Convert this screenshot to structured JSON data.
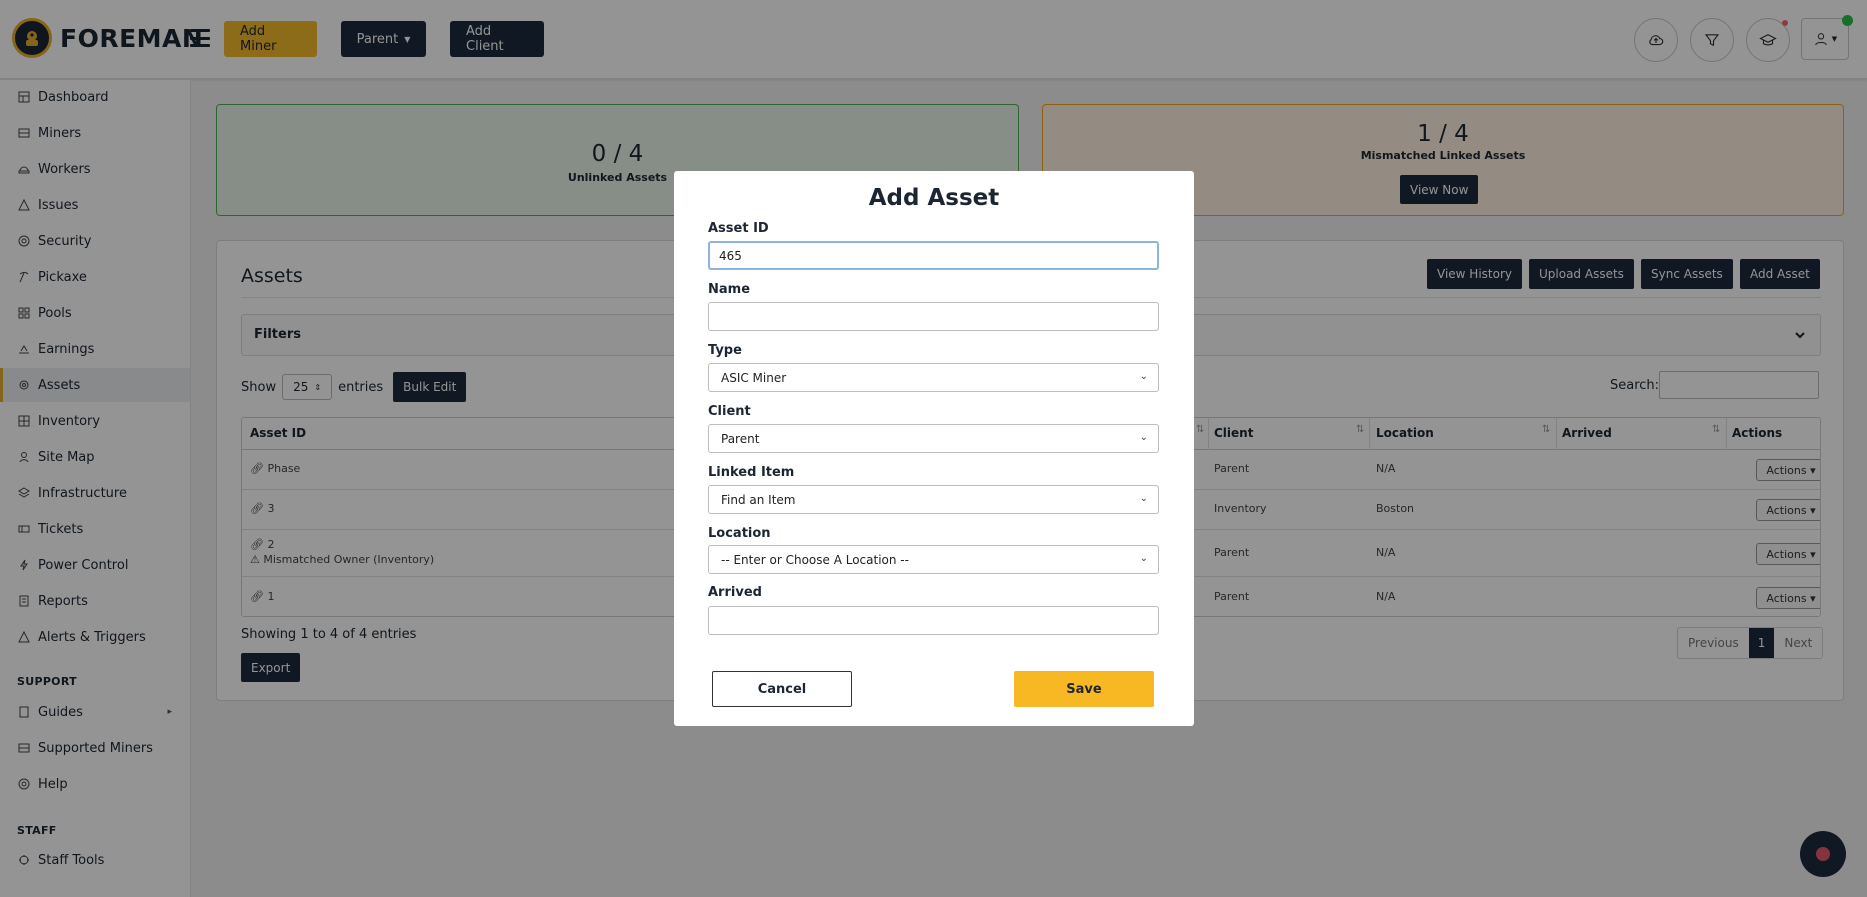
{
  "header": {
    "logo_text": "FOREMAN",
    "add_miner_label": "Add Miner",
    "parent_label": "Parent",
    "add_client_label": "Add Client"
  },
  "sidebar": {
    "items": [
      {
        "label": "Dashboard",
        "icon": "dashboard-icon"
      },
      {
        "label": "Miners",
        "icon": "miners-icon"
      },
      {
        "label": "Workers",
        "icon": "workers-icon"
      },
      {
        "label": "Issues",
        "icon": "issues-icon"
      },
      {
        "label": "Security",
        "icon": "security-icon"
      },
      {
        "label": "Pickaxe",
        "icon": "pickaxe-icon"
      },
      {
        "label": "Pools",
        "icon": "pools-icon"
      },
      {
        "label": "Earnings",
        "icon": "earnings-icon"
      },
      {
        "label": "Assets",
        "icon": "assets-icon",
        "active": true
      },
      {
        "label": "Inventory",
        "icon": "inventory-icon"
      },
      {
        "label": "Site Map",
        "icon": "site-map-icon"
      },
      {
        "label": "Infrastructure",
        "icon": "infrastructure-icon"
      },
      {
        "label": "Tickets",
        "icon": "tickets-icon"
      },
      {
        "label": "Power Control",
        "icon": "power-icon"
      },
      {
        "label": "Reports",
        "icon": "reports-icon"
      },
      {
        "label": "Alerts & Triggers",
        "icon": "alerts-icon"
      }
    ],
    "support_heading": "SUPPORT",
    "support_items": [
      {
        "label": "Guides",
        "icon": "guides-icon"
      },
      {
        "label": "Supported Miners",
        "icon": "supported-miners-icon"
      },
      {
        "label": "Help",
        "icon": "help-icon"
      }
    ],
    "staff_heading": "STAFF",
    "staff_items": [
      {
        "label": "Staff Tools",
        "icon": "staff-tools-icon"
      }
    ]
  },
  "stats": {
    "unlinked": {
      "value": "0 / 4",
      "label": "Unlinked Assets"
    },
    "mismatched": {
      "value": "1 / 4",
      "label": "Mismatched Linked Assets",
      "button": "View Now"
    }
  },
  "assets": {
    "title": "Assets",
    "buttons": {
      "view_history": "View History",
      "upload_assets": "Upload Assets",
      "sync_assets": "Sync Assets",
      "add_asset": "Add Asset"
    },
    "filters_label": "Filters",
    "show_label": "Show",
    "page_length": "25",
    "entries_label": "entries",
    "bulk_edit": "Bulk Edit",
    "search_label": "Search:",
    "columns": [
      "Asset ID",
      "Client",
      "Location",
      "Arrived",
      "Actions"
    ],
    "rows": [
      {
        "asset_id": "Phase",
        "warning": "",
        "client": "Parent",
        "location": "N/A",
        "arrived": "",
        "action": "Actions"
      },
      {
        "asset_id": "3",
        "warning": "",
        "client": "Inventory",
        "location": "Boston",
        "arrived": "",
        "action": "Actions"
      },
      {
        "asset_id": "2",
        "warning": "Mismatched Owner (Inventory)",
        "client": "Parent",
        "location": "N/A",
        "arrived": "",
        "action": "Actions"
      },
      {
        "asset_id": "1",
        "warning": "",
        "client": "Parent",
        "location": "N/A",
        "arrived": "",
        "action": "Actions"
      }
    ],
    "showing": "Showing 1 to 4 of 4 entries",
    "export": "Export",
    "pager": {
      "previous": "Previous",
      "current": "1",
      "next": "Next"
    }
  },
  "modal": {
    "title": "Add Asset",
    "asset_id_label": "Asset ID",
    "asset_id_value": "465",
    "name_label": "Name",
    "name_value": "",
    "type_label": "Type",
    "type_value": "ASIC Miner",
    "client_label": "Client",
    "client_value": "Parent",
    "linked_item_label": "Linked Item",
    "linked_item_value": "Find an Item",
    "location_label": "Location",
    "location_value": "-- Enter or Choose A Location --",
    "arrived_label": "Arrived",
    "arrived_value": "",
    "cancel": "Cancel",
    "save": "Save"
  },
  "colors": {
    "brand_yellow": "#f1b82b",
    "navy": "#1c2a3d",
    "green_card_border": "#4caf50",
    "orange_card_border": "#f5a623"
  }
}
